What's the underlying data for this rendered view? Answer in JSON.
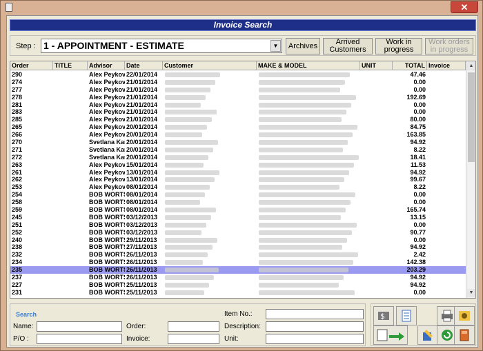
{
  "window": {
    "title": "Invoice Search",
    "close_label": "✕"
  },
  "step": {
    "label": "Step :",
    "selected": "1 - APPOINTMENT - ESTIMATE"
  },
  "buttons": {
    "archives": "Archives",
    "arrived_customers": "Arrived Customers",
    "work_in_progress": "Work in progress",
    "work_orders_in_progress": "Work orders in progress"
  },
  "columns": [
    "Order",
    "TITLE",
    "Advisor",
    "Date",
    "Customer",
    "MAKE & MODEL",
    "UNIT",
    "TOTAL",
    "Invoice"
  ],
  "rows": [
    {
      "order": "290",
      "advisor": "Alex Peykov",
      "date": "22/01/2014",
      "total": "47.46"
    },
    {
      "order": "274",
      "advisor": "Alex Peykov",
      "date": "21/01/2014",
      "total": "0.00"
    },
    {
      "order": "277",
      "advisor": "Alex Peykov",
      "date": "21/01/2014",
      "total": "0.00"
    },
    {
      "order": "278",
      "advisor": "Alex Peykov",
      "date": "21/01/2014",
      "total": "192.69"
    },
    {
      "order": "281",
      "advisor": "Alex Peykov",
      "date": "21/01/2014",
      "total": "0.00"
    },
    {
      "order": "283",
      "advisor": "Alex Peykov",
      "date": "21/01/2014",
      "total": "0.00"
    },
    {
      "order": "285",
      "advisor": "Alex Peykov",
      "date": "21/01/2014",
      "total": "80.00"
    },
    {
      "order": "265",
      "advisor": "Alex Peykov",
      "date": "20/01/2014",
      "total": "84.75"
    },
    {
      "order": "266",
      "advisor": "Alex Peykov",
      "date": "20/01/2014",
      "total": "163.85"
    },
    {
      "order": "270",
      "advisor": "Svetlana Kan",
      "date": "20/01/2014",
      "total": "94.92"
    },
    {
      "order": "271",
      "advisor": "Svetlana Kan",
      "date": "20/01/2014",
      "total": "8.22"
    },
    {
      "order": "272",
      "advisor": "Svetlana Kan",
      "date": "20/01/2014",
      "total": "18.41"
    },
    {
      "order": "263",
      "advisor": "Alex Peykov",
      "date": "15/01/2014",
      "total": "11.53"
    },
    {
      "order": "261",
      "advisor": "Alex Peykov",
      "date": "13/01/2014",
      "total": "94.92"
    },
    {
      "order": "262",
      "advisor": "Alex Peykov",
      "date": "13/01/2014",
      "total": "99.67"
    },
    {
      "order": "253",
      "advisor": "Alex Peykov",
      "date": "08/01/2014",
      "total": "8.22"
    },
    {
      "order": "254",
      "advisor": "BOB WORTS",
      "date": "08/01/2014",
      "total": "0.00"
    },
    {
      "order": "258",
      "advisor": "BOB WORTS",
      "date": "08/01/2014",
      "total": "0.00"
    },
    {
      "order": "259",
      "advisor": "BOB WORTS",
      "date": "08/01/2014",
      "total": "165.74"
    },
    {
      "order": "245",
      "advisor": "BOB WORTS",
      "date": "03/12/2013",
      "total": "13.15"
    },
    {
      "order": "251",
      "advisor": "BOB WORTS",
      "date": "03/12/2013",
      "total": "0.00"
    },
    {
      "order": "252",
      "advisor": "BOB WORTS",
      "date": "03/12/2013",
      "total": "90.77"
    },
    {
      "order": "240",
      "advisor": "BOB WORTS",
      "date": "29/11/2013",
      "total": "0.00"
    },
    {
      "order": "238",
      "advisor": "BOB WORTS",
      "date": "27/11/2013",
      "total": "94.92"
    },
    {
      "order": "232",
      "advisor": "BOB WORTS",
      "date": "26/11/2013",
      "total": "2.42"
    },
    {
      "order": "234",
      "advisor": "BOB WORTS",
      "date": "26/11/2013",
      "total": "142.38"
    },
    {
      "order": "235",
      "advisor": "BOB WORTS",
      "date": "26/11/2013",
      "total": "203.29",
      "selected": true
    },
    {
      "order": "237",
      "advisor": "BOB WORTS",
      "date": "26/11/2013",
      "total": "94.92"
    },
    {
      "order": "227",
      "advisor": "BOB WORTS",
      "date": "25/11/2013",
      "total": "94.92"
    },
    {
      "order": "231",
      "advisor": "BOB WORTS",
      "date": "25/11/2013",
      "total": "0.00"
    }
  ],
  "search": {
    "title": "Search",
    "name_label": "Name:",
    "po_label": "P/O :",
    "order_label": "Order:",
    "invoice_label": "Invoice:",
    "item_no_label": "Item No.:",
    "description_label": "Description:",
    "unit_label": "Unit:",
    "name_value": "",
    "po_value": "",
    "order_value": "",
    "invoice_value": "",
    "item_no_value": "",
    "description_value": "",
    "unit_value": ""
  },
  "actions": {
    "icons": [
      "cash-register-icon",
      "document-icon",
      "printer-icon",
      "settings-icon",
      "edit-arrow-icon",
      "notes-icon",
      "refresh-icon",
      "exit-door-icon"
    ]
  },
  "colors": {
    "header": "#1e2f8a",
    "selected_row": "#9a9af0",
    "search_title": "#3a7bd5"
  }
}
